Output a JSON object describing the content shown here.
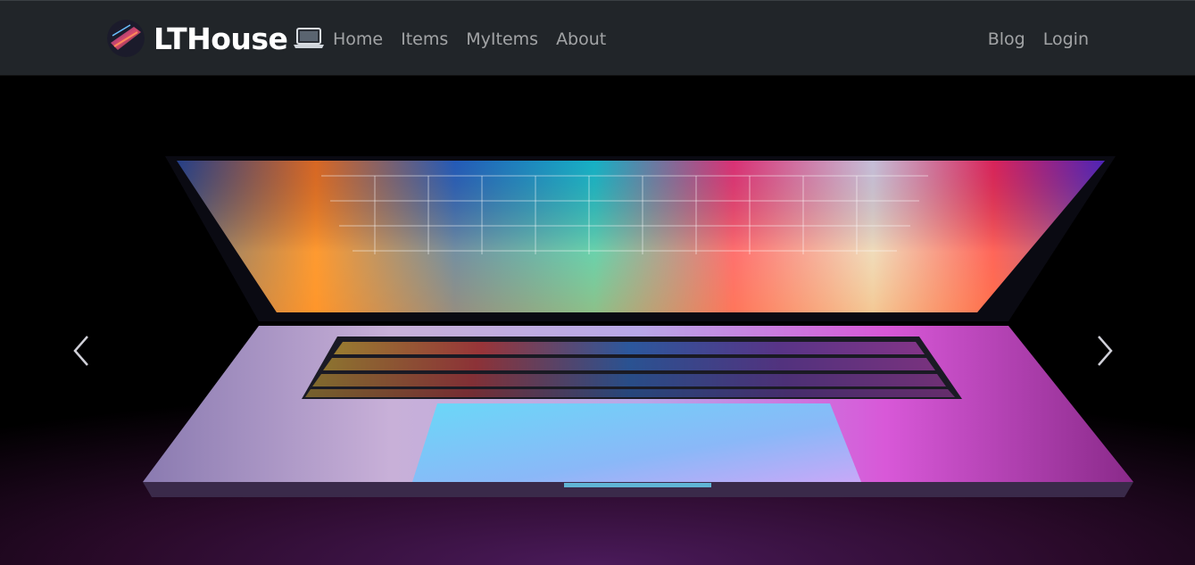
{
  "brand": {
    "name": "LTHouse",
    "logo_icon": "brand-logo-icon",
    "emoji_icon": "laptop-emoji-icon"
  },
  "nav": {
    "left": [
      {
        "label": "Home"
      },
      {
        "label": "Items"
      },
      {
        "label": "MyItems"
      },
      {
        "label": "About"
      }
    ],
    "right": [
      {
        "label": "Blog"
      },
      {
        "label": "Login"
      }
    ]
  },
  "carousel": {
    "slide_image": "glowing-laptop-image",
    "prev_icon": "chevron-left-icon",
    "next_icon": "chevron-right-icon"
  },
  "colors": {
    "navbar_bg": "#212529",
    "nav_link": "rgba(255,255,255,0.58)",
    "brand_text": "#ffffff"
  }
}
